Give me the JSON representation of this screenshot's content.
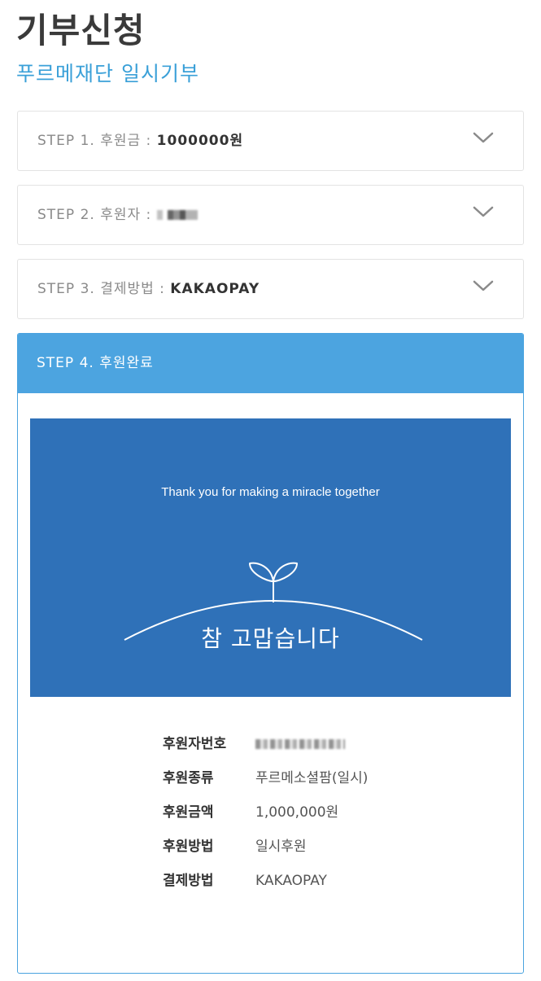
{
  "header": {
    "title": "기부신청",
    "subtitle": "푸르메재단 일시기부"
  },
  "steps": [
    {
      "label": "STEP 1. 후원금 : ",
      "value": "1000000원"
    },
    {
      "label": "STEP 2. 후원자 : ",
      "value": ""
    },
    {
      "label": "STEP 3. 결제방법 : ",
      "value": "KAKAOPAY"
    }
  ],
  "step4": {
    "title": "STEP 4. 후원완료",
    "banner": {
      "caption": "Thank you for making a miracle together",
      "message": "참 고맙습니다"
    },
    "details": [
      {
        "label": "후원자번호",
        "value": ""
      },
      {
        "label": "후원종류",
        "value": "푸르메소셜팜(일시)"
      },
      {
        "label": "후원금액",
        "value": "1,000,000원"
      },
      {
        "label": "후원방법",
        "value": "일시후원"
      },
      {
        "label": "결제방법",
        "value": "KAKAOPAY"
      }
    ]
  },
  "icons": {
    "expand": "chevron-down-icon",
    "sprout": "sprout-icon"
  },
  "colors": {
    "accent": "#3aa0d8",
    "step_header": "#4ca4e0",
    "banner": "#2f71b8"
  }
}
